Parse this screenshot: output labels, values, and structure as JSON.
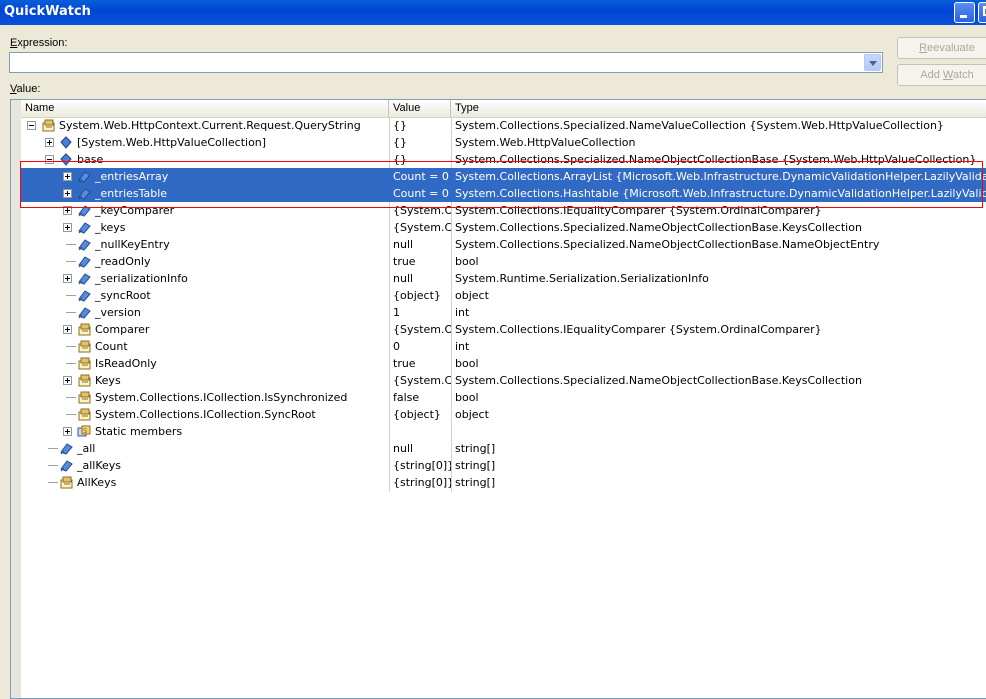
{
  "window": {
    "title": "QuickWatch"
  },
  "expression": {
    "label_first": "E",
    "label_rest": "xpression:",
    "value": ""
  },
  "value_label": {
    "first": "V",
    "rest": "alue:"
  },
  "buttons": {
    "reevaluate_first": "R",
    "reevaluate_rest": "eevaluate",
    "addwatch_pre": "Add ",
    "addwatch_u": "W",
    "addwatch_post": "atch"
  },
  "columns": {
    "name": "Name",
    "value": "Value",
    "type": "Type"
  },
  "rows": [
    {
      "name": "System.Web.HttpContext.Current.Request.QueryString",
      "value": "{}",
      "type": "System.Collections.Specialized.NameValueCollection {System.Web.HttpValueCollection}",
      "icon": "property-icon",
      "expander": "minus"
    },
    {
      "name": "[System.Web.HttpValueCollection]",
      "value": "{}",
      "type": "System.Web.HttpValueCollection",
      "icon": "class-icon",
      "expander": "plus"
    },
    {
      "name": "base",
      "value": "{}",
      "type": "System.Collections.Specialized.NameObjectCollectionBase {System.Web.HttpValueCollection}",
      "icon": "class-icon",
      "expander": "minus"
    },
    {
      "name": "_entriesArray",
      "value": "Count = 0",
      "type": "System.Collections.ArrayList {Microsoft.Web.Infrastructure.DynamicValidationHelper.LazilyValidatingArrayList}",
      "icon": "field-icon",
      "expander": "plus",
      "selected": true
    },
    {
      "name": "_entriesTable",
      "value": "Count = 0",
      "type": "System.Collections.Hashtable {Microsoft.Web.Infrastructure.DynamicValidationHelper.LazilyValidatingHashtable}",
      "icon": "field-icon",
      "expander": "plus",
      "selected": true
    },
    {
      "name": "_keyComparer",
      "value": "{System.OrdinalComparer}",
      "type": "System.Collections.IEqualityComparer {System.OrdinalComparer}",
      "icon": "field-icon",
      "expander": "plus"
    },
    {
      "name": "_keys",
      "value": "{System.Collections.Specialized.NameObjectCollectionBase.KeysCollection}",
      "type": "System.Collections.Specialized.NameObjectCollectionBase.KeysCollection",
      "icon": "field-icon",
      "expander": "plus"
    },
    {
      "name": "_nullKeyEntry",
      "value": "null",
      "type": "System.Collections.Specialized.NameObjectCollectionBase.NameObjectEntry",
      "icon": "field-icon",
      "expander": ""
    },
    {
      "name": "_readOnly",
      "value": "true",
      "type": "bool",
      "icon": "field-icon",
      "expander": ""
    },
    {
      "name": "_serializationInfo",
      "value": "null",
      "type": "System.Runtime.Serialization.SerializationInfo",
      "icon": "field-icon",
      "expander": "plus"
    },
    {
      "name": "_syncRoot",
      "value": "{object}",
      "type": "object",
      "icon": "field-icon",
      "expander": ""
    },
    {
      "name": "_version",
      "value": "1",
      "type": "int",
      "icon": "field-icon",
      "expander": ""
    },
    {
      "name": "Comparer",
      "value": "{System.OrdinalComparer}",
      "type": "System.Collections.IEqualityComparer {System.OrdinalComparer}",
      "icon": "property-icon",
      "expander": "plus"
    },
    {
      "name": "Count",
      "value": "0",
      "type": "int",
      "icon": "property-icon",
      "expander": ""
    },
    {
      "name": "IsReadOnly",
      "value": "true",
      "type": "bool",
      "icon": "property-icon",
      "expander": ""
    },
    {
      "name": "Keys",
      "value": "{System.Collections.Specialized.NameObjectCollectionBase.KeysCollection}",
      "type": "System.Collections.Specialized.NameObjectCollectionBase.KeysCollection",
      "icon": "property-icon",
      "expander": "plus"
    },
    {
      "name": "System.Collections.ICollection.IsSynchronized",
      "value": "false",
      "type": "bool",
      "icon": "property-icon",
      "expander": ""
    },
    {
      "name": "System.Collections.ICollection.SyncRoot",
      "value": "{object}",
      "type": "object",
      "icon": "property-icon",
      "expander": ""
    },
    {
      "name": "Static members",
      "value": "",
      "type": "",
      "icon": "static-members-icon",
      "expander": "plus"
    },
    {
      "name": "_all",
      "value": "null",
      "type": "string[]",
      "icon": "field-icon",
      "expander": ""
    },
    {
      "name": "_allKeys",
      "value": "{string[0]}",
      "type": "string[]",
      "icon": "field-icon",
      "expander": ""
    },
    {
      "name": "AllKeys",
      "value": "{string[0]}",
      "type": "string[]",
      "icon": "property-icon",
      "expander": ""
    }
  ]
}
